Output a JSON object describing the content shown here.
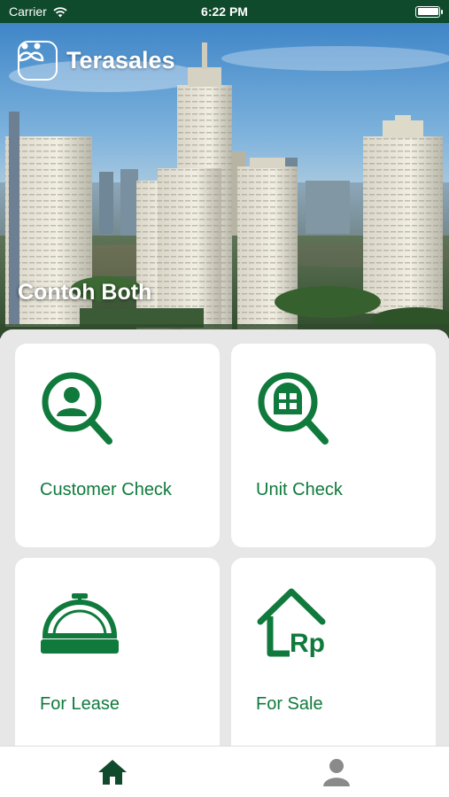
{
  "status_bar": {
    "carrier": "Carrier",
    "time": "6:22 PM"
  },
  "header": {
    "app_name": "Terasales",
    "project_name": "Contoh Both"
  },
  "menu": {
    "tiles": [
      {
        "label": "Customer Check",
        "icon": "customer-search-icon"
      },
      {
        "label": "Unit Check",
        "icon": "unit-search-icon"
      },
      {
        "label": "For Lease",
        "icon": "service-bell-icon"
      },
      {
        "label": "For Sale",
        "icon": "house-rp-icon"
      }
    ]
  },
  "tab_bar": {
    "items": [
      {
        "icon": "home-icon",
        "active": true
      },
      {
        "icon": "profile-icon",
        "active": false
      }
    ]
  },
  "colors": {
    "brand_green": "#0f7a3c",
    "status_bar": "#0f4a2c",
    "tab_active": "#0f4a2c",
    "tab_inactive": "#8a8a8a",
    "background": "#e7e7e7"
  }
}
